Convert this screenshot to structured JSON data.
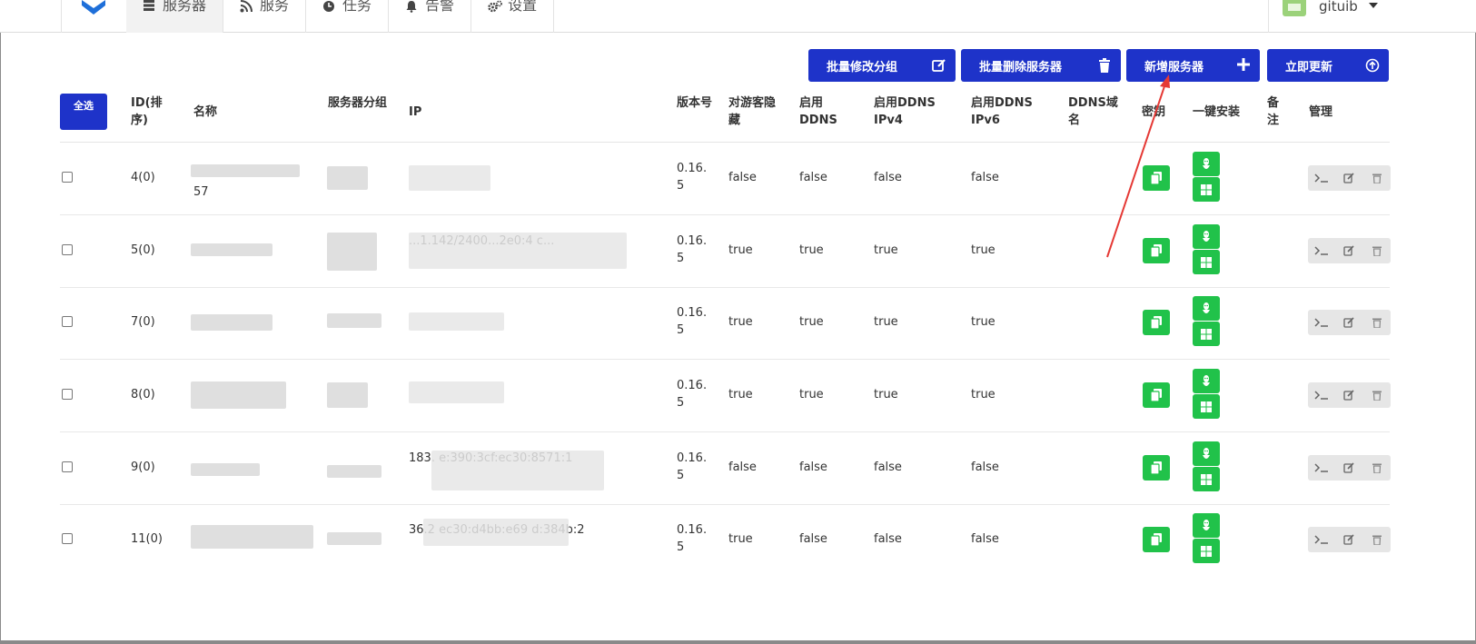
{
  "nav": {
    "items": [
      {
        "label": "服务器",
        "icon": "server-icon",
        "active": true
      },
      {
        "label": "服务",
        "icon": "rss-icon",
        "active": false
      },
      {
        "label": "任务",
        "icon": "clock-icon",
        "active": false
      },
      {
        "label": "告警",
        "icon": "bell-icon",
        "active": false
      },
      {
        "label": "设置",
        "icon": "gears-icon",
        "active": false
      }
    ],
    "username": "gituib"
  },
  "actions": {
    "batch_group": "批量修改分组",
    "batch_delete": "批量删除服务器",
    "add_server": "新增服务器",
    "update_now": "立即更新"
  },
  "table": {
    "select_all": "全选",
    "headers": {
      "id": "ID(排序)",
      "name": "名称",
      "group": "服务器分组",
      "ip": "IP",
      "version": "版本号",
      "hide_guest": "对游客隐藏",
      "ddns": "启用DDNS",
      "ddns_v4": "启用DDNS IPv4",
      "ddns_v6": "启用DDNS IPv6",
      "ddns_domain": "DDNS域名",
      "secret": "密钥",
      "install": "一键安装",
      "note": "备注",
      "manage": "管理"
    },
    "rows": [
      {
        "id": "4(0)",
        "name_tail": "57",
        "ip": "",
        "version": "0.16.5",
        "hide": "false",
        "ddns": "false",
        "v4": "false",
        "v6": "false"
      },
      {
        "id": "5(0)",
        "name_tail": "",
        "ip": "...1.142/2400...2e0:4 c...",
        "version": "0.16.5",
        "hide": "true",
        "ddns": "true",
        "v4": "true",
        "v6": "true"
      },
      {
        "id": "7(0)",
        "name_tail": "",
        "ip": "",
        "version": "0.16.5",
        "hide": "true",
        "ddns": "true",
        "v4": "true",
        "v6": "true"
      },
      {
        "id": "8(0)",
        "name_tail": "",
        "ip": "",
        "version": "0.16.5",
        "hide": "true",
        "ddns": "true",
        "v4": "true",
        "v6": "true"
      },
      {
        "id": "9(0)",
        "name_tail": "",
        "ip": "183.            e:390:3cf:ec30:8571:1",
        "version": "0.16.5",
        "hide": "false",
        "ddns": "false",
        "v4": "false",
        "v6": "false"
      },
      {
        "id": "11(0)",
        "name_tail": "",
        "ip": "36.2              ec30:d4bb:e69 d:384b:2",
        "version": "0.16.5",
        "hide": "true",
        "ddns": "false",
        "v4": "false",
        "v6": "false"
      }
    ]
  },
  "colors": {
    "primary": "#1e33c9",
    "success": "#21c24a",
    "annotation_arrow": "#e53935"
  }
}
